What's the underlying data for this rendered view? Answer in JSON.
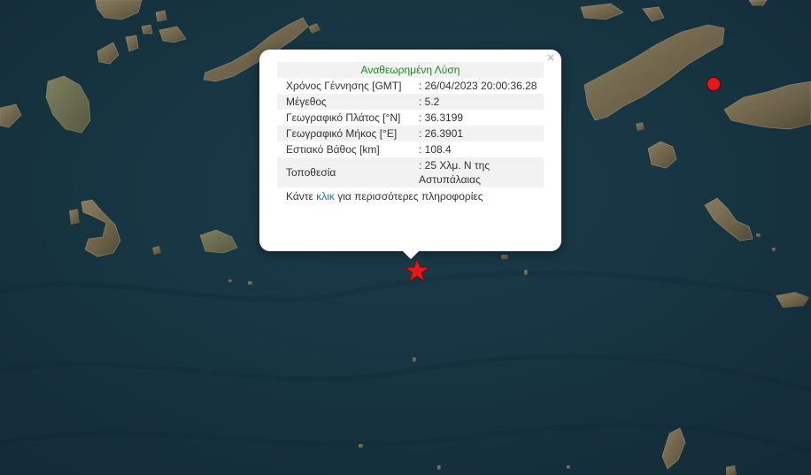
{
  "popup": {
    "title": "Αναθεωρημένη Λύση",
    "close_symbol": "×",
    "rows": [
      {
        "label": "Χρόνος Γέννησης [GMT]",
        "value": ": 26/04/2023 20:00:36.28"
      },
      {
        "label": "Μέγεθος",
        "value": ": 5.2"
      },
      {
        "label": "Γεωγραφικό Πλάτος [°N]",
        "value": ": 36.3199"
      },
      {
        "label": "Γεωγραφικό Μήκος [°E]",
        "value": ": 26.3901"
      },
      {
        "label": "Εστιακό Βάθος [km]",
        "value": ": 108.4"
      },
      {
        "label": "Τοποθεσία",
        "value": ": 25 Χλμ. N της Αστυπάλαιας"
      }
    ],
    "more_prefix": "Κάντε ",
    "more_link": "κλικ",
    "more_suffix": " για περισσότερες πληροφορίες"
  },
  "markers": {
    "epicenter_icon": "star-icon",
    "epicenter_color": "#e31a1c",
    "other_event_icon": "circle-icon",
    "other_event_color": "#e31a1c"
  },
  "colors": {
    "sea": "#173644",
    "land": "#6e6450",
    "title_green": "#1d8a1d",
    "link_blue": "#1f6fb2"
  }
}
